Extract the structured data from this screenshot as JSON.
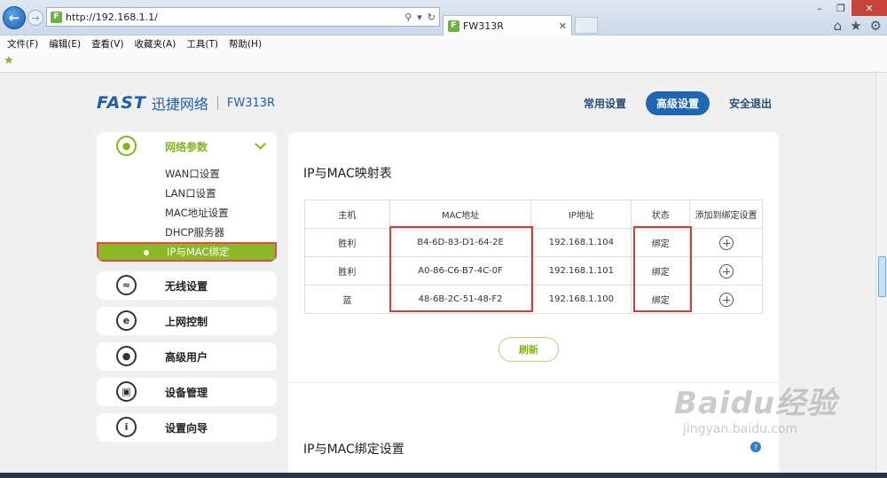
{
  "browser": {
    "url": "http://192.168.1.1/",
    "favicon_letter": "F",
    "tab_title": "FW313R",
    "menu": [
      "文件(F)",
      "编辑(E)",
      "查看(V)",
      "收藏夹(A)",
      "工具(T)",
      "帮助(H)"
    ],
    "icons": [
      "back-arrow-icon",
      "forward-arrow-icon",
      "search-icon",
      "refresh-icon",
      "home-icon",
      "star-icon",
      "gear-icon"
    ]
  },
  "header": {
    "brand": "FAST",
    "brand_cn": "迅捷网络",
    "model": "FW313R",
    "nav": [
      "常用设置",
      "高级设置",
      "安全退出"
    ],
    "active_nav": "高级设置"
  },
  "sidebar": {
    "open_group": {
      "label": "网络参数",
      "items": [
        "WAN口设置",
        "LAN口设置",
        "MAC地址设置",
        "DHCP服务器",
        "IP与MAC绑定"
      ],
      "active_item": "IP与MAC绑定"
    },
    "groups": [
      {
        "label": "无线设置",
        "icon": "wifi-icon"
      },
      {
        "label": "上网控制",
        "icon": "internet-e-icon"
      },
      {
        "label": "高级用户",
        "icon": "user-icon"
      },
      {
        "label": "设备管理",
        "icon": "device-icon"
      },
      {
        "label": "设置向导",
        "icon": "info-icon"
      }
    ]
  },
  "main": {
    "table_title": "IP与MAC映射表",
    "columns": [
      "主机",
      "MAC地址",
      "IP地址",
      "状态",
      "添加到绑定设置"
    ],
    "rows": [
      {
        "host": "胜利",
        "mac": "B4-6D-83-D1-64-2E",
        "ip": "192.168.1.104",
        "status": "绑定"
      },
      {
        "host": "胜利",
        "mac": "A0-86-C6-B7-4C-0F",
        "ip": "192.168.1.101",
        "status": "绑定"
      },
      {
        "host": "蓝",
        "mac": "48-6B-2C-51-48-F2",
        "ip": "192.168.1.100",
        "status": "绑定"
      }
    ],
    "refresh_label": "刷新",
    "section2_title": "IP与MAC绑定设置",
    "help_glyph": "?"
  },
  "watermark": {
    "main": "Baidu经验",
    "sub": "jingyan.baidu.com"
  }
}
